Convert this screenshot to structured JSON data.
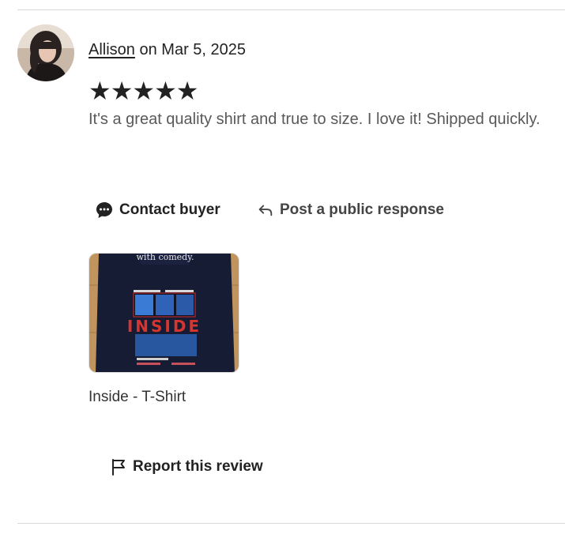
{
  "review": {
    "reviewer_name": "Allison",
    "date_text": " on Mar 5, 2025",
    "rating_stars": "★★★★★",
    "rating": 5,
    "text": "It's a great quality shirt and true to size. I love it! Shipped quickly."
  },
  "actions": {
    "contact_label": "Contact buyer",
    "public_response_label": "Post a public response"
  },
  "product": {
    "name": "Inside - T-Shirt",
    "shirt_top_text": "with comedy.",
    "shirt_title": "INSIDE"
  },
  "report": {
    "label": "Report this review"
  }
}
